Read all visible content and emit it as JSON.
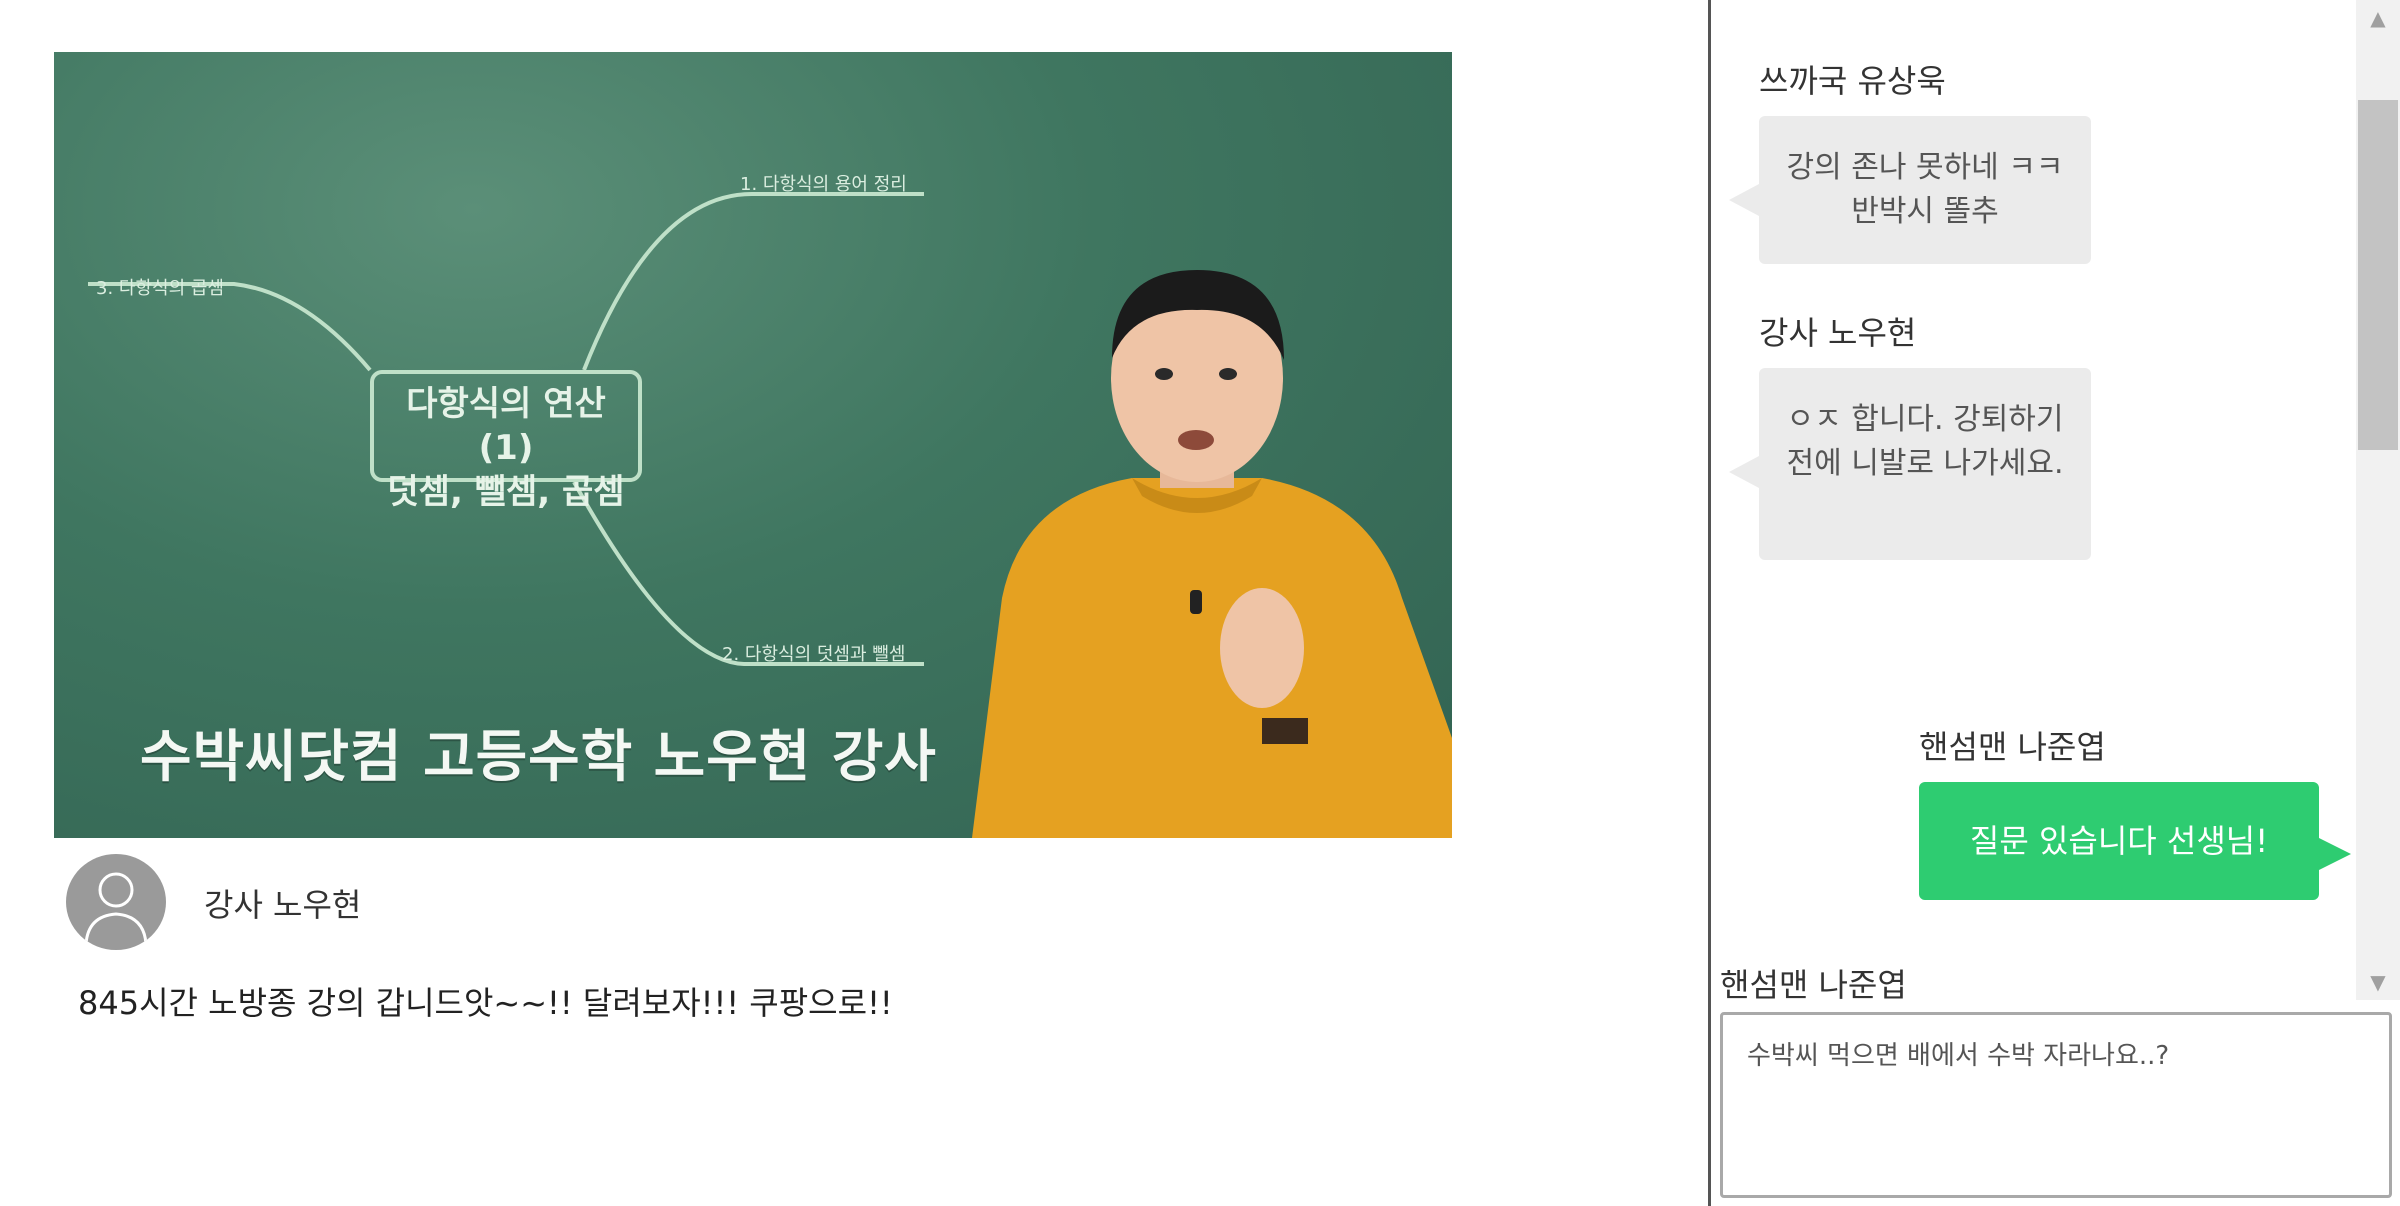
{
  "video": {
    "board_title_line1": "다항식의 연산 (1)",
    "board_title_line2": "덧셈, 뺄셈, 곱셈",
    "branch1": "1. 다항식의 용어 정리",
    "branch2": "2. 다항식의 덧셈과 뺄셈",
    "branch3": "3. 다항식의 곱셈",
    "caption": "수박씨닷컴 고등수학 노우현 강사"
  },
  "post": {
    "author": "강사 노우현",
    "text": "845시간 노방종 강의 갑니드앗~~!! 달려보자!!! 쿠팡으로!!"
  },
  "chat": {
    "messages": [
      {
        "sender": "쓰까국 유상욱",
        "text": "강의 존나 못하네 ㅋㅋ 반박시 똘추"
      },
      {
        "sender": "강사 노우현",
        "text": "ㅇㅈ 합니다. 강퇴하기 전에 니발로 나가세요."
      },
      {
        "sender": "핸섬맨 나준엽",
        "text": "질문 있습니다 선생님!"
      }
    ],
    "input_user": "핸섬맨 나준엽",
    "input_value": "수박씨 먹으면 배에서 수박 자라나요..?"
  },
  "colors": {
    "board": "#3f7660",
    "my_bubble": "#2ecc71",
    "other_bubble": "#ebebeb"
  },
  "icons": {
    "avatar": "user-silhouette-icon",
    "scroll_up": "triangle-up-icon",
    "scroll_down": "triangle-down-icon"
  }
}
